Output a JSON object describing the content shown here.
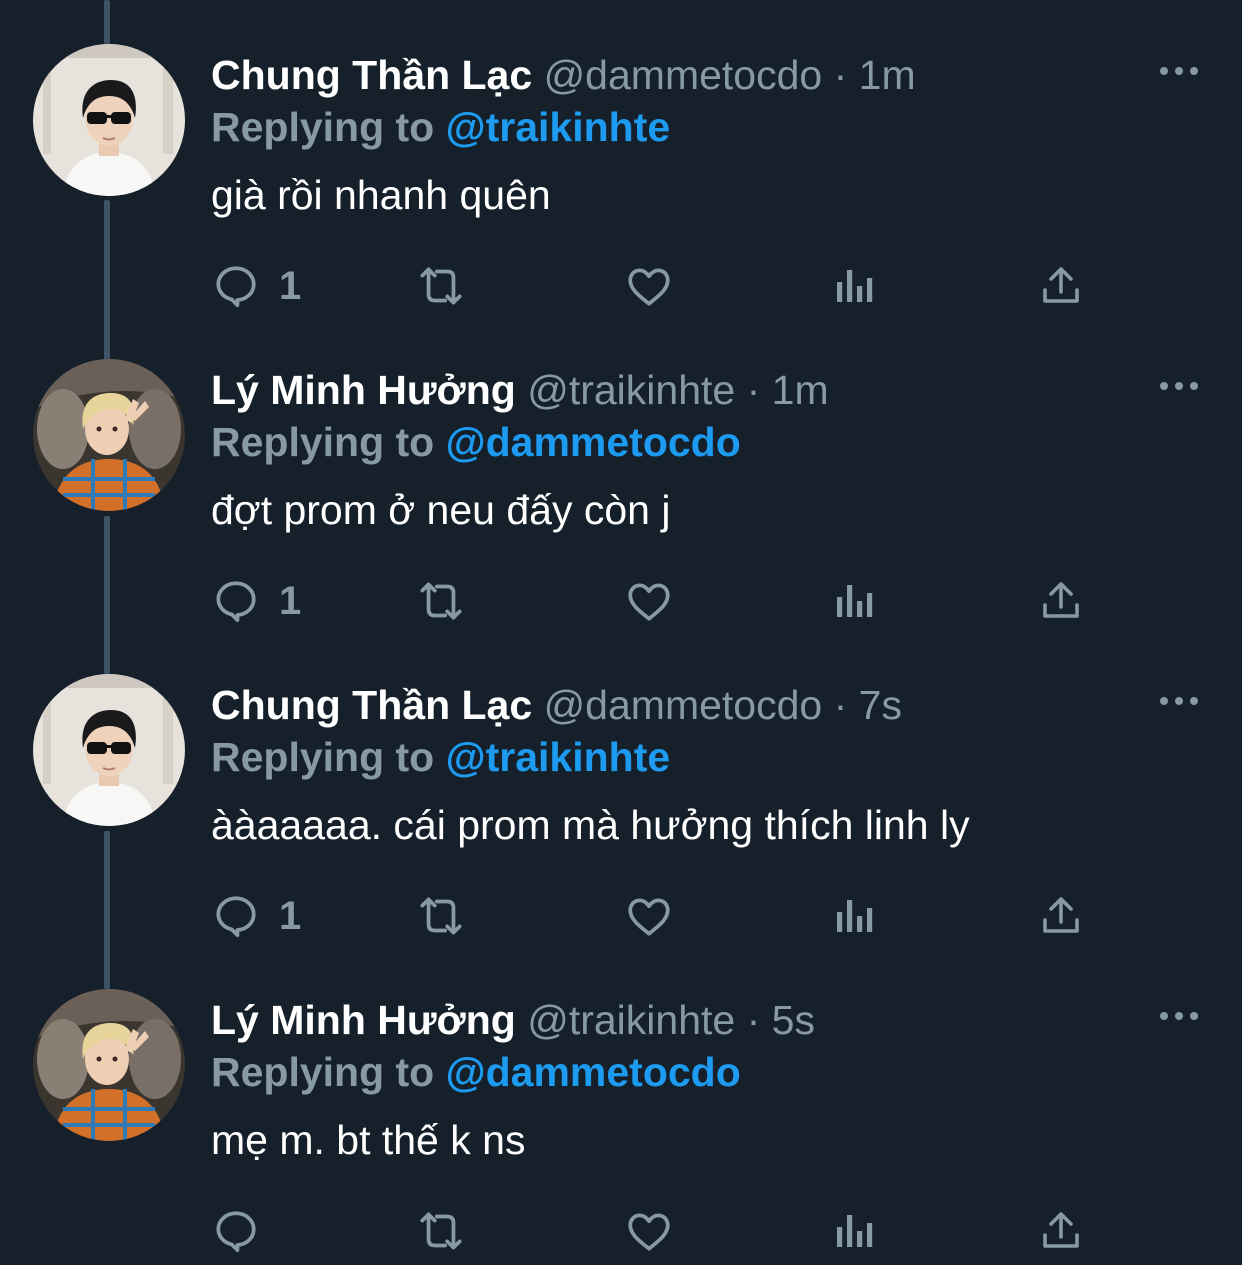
{
  "colors": {
    "background": "#15202b",
    "thread_line": "#3d5466",
    "secondary_text": "#8899a6",
    "link": "#1d9bf0",
    "primary_text": "#ffffff"
  },
  "tweets": [
    {
      "display_name": "Chung Thần Lạc",
      "handle": "@dammetocdo",
      "separator": "·",
      "time": "1m",
      "reply_prefix": "Replying to",
      "reply_to": "@traikinhte",
      "text": "già rồi nhanh quên",
      "reply_count": "1",
      "avatar_icon": "avatar-boy-sunglasses"
    },
    {
      "display_name": "Lý Minh Hưởng",
      "handle": "@traikinhte",
      "separator": "·",
      "time": "1m",
      "reply_prefix": "Replying to",
      "reply_to": "@dammetocdo",
      "text": "đợt prom ở neu đấy còn j",
      "reply_count": "1",
      "avatar_icon": "avatar-boy-plaid-shirt"
    },
    {
      "display_name": "Chung Thần Lạc",
      "handle": "@dammetocdo",
      "separator": "·",
      "time": "7s",
      "reply_prefix": "Replying to",
      "reply_to": "@traikinhte",
      "text": "ààaaaaa. cái prom mà hưởng thích linh ly",
      "reply_count": "1",
      "avatar_icon": "avatar-boy-sunglasses"
    },
    {
      "display_name": "Lý Minh Hưởng",
      "handle": "@traikinhte",
      "separator": "·",
      "time": "5s",
      "reply_prefix": "Replying to",
      "reply_to": "@dammetocdo",
      "text": "mẹ m. bt thế k ns",
      "reply_count": "",
      "avatar_icon": "avatar-boy-plaid-shirt"
    }
  ],
  "action_icons": [
    "reply-icon",
    "retweet-icon",
    "like-icon",
    "analytics-icon",
    "share-icon"
  ],
  "more_icon": "more-options-icon"
}
